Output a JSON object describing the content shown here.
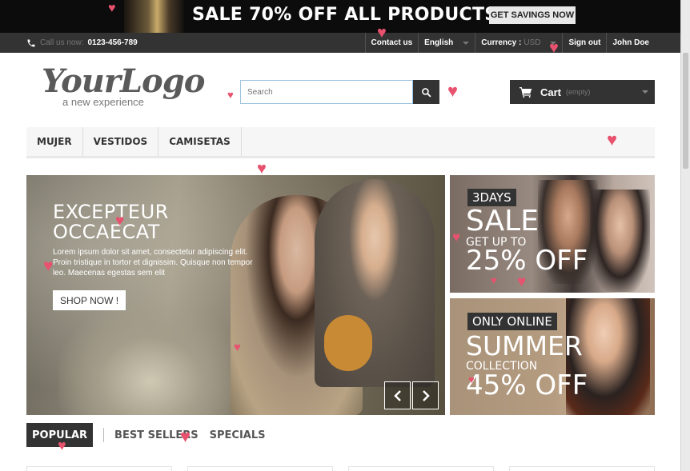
{
  "promo": {
    "text": "SALE 70% OFF ALL PRODUCTS",
    "button": "GET SAVINGS NOW"
  },
  "nav": {
    "call_label": "Call us now:",
    "phone": "0123-456-789",
    "contact": "Contact us",
    "language": "English",
    "currency_label": "Currency :",
    "currency_value": "USD",
    "sign_out": "Sign out",
    "user": "John Doe"
  },
  "header": {
    "logo_main": "YourLogo",
    "logo_tagline": "a new experience",
    "search_placeholder": "Search",
    "cart_label": "Cart",
    "cart_status": "(empty)"
  },
  "menu": {
    "items": [
      "MUJER",
      "VESTIDOS",
      "CAMISETAS"
    ]
  },
  "slider": {
    "title_line1": "EXCEPTEUR",
    "title_line2": "OCCAECAT",
    "description": "Lorem ipsum dolor sit amet, consectetur adipiscing elit. Proin tristique in tortor et dignissim. Quisque non tempor leo. Maecenas egestas sem elit",
    "button": "SHOP NOW !"
  },
  "banners": {
    "b1_tag": "3DAYS",
    "b1_sale": "SALE",
    "b1_up": "GET UP TO",
    "b1_off": "25% OFF",
    "b2_tag": "ONLY ONLINE",
    "b2_title": "SUMMER",
    "b2_sub": "COLLECTION",
    "b2_off": "45% OFF"
  },
  "tabs": {
    "items": [
      "POPULAR",
      "BEST SELLERS",
      "SPECIALS"
    ],
    "active": "POPULAR"
  },
  "icons": {
    "phone": "phone-icon",
    "search": "search-icon",
    "cart": "cart-icon",
    "prev": "chevron-left-icon",
    "next": "chevron-right-icon",
    "heart": "heart-icon"
  },
  "colors": {
    "dark": "#333333",
    "heart": "#e8526e",
    "search_border": "#9bc3e0"
  }
}
